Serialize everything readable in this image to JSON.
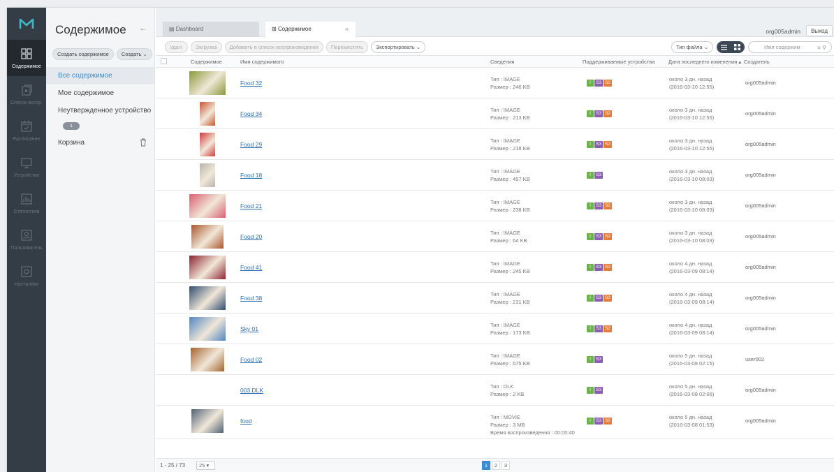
{
  "rail": {
    "items": [
      {
        "label": "Содержимое",
        "icon": "content-icon",
        "active": true
      },
      {
        "label": "Список воспр.",
        "icon": "playlist-icon"
      },
      {
        "label": "Расписание",
        "icon": "schedule-icon"
      },
      {
        "label": "Устройство",
        "icon": "device-icon"
      },
      {
        "label": "Статистика",
        "icon": "statistics-icon"
      },
      {
        "label": "Пользователь",
        "icon": "user-icon"
      },
      {
        "label": "Настройки",
        "icon": "settings-icon"
      }
    ]
  },
  "nav": {
    "title": "Содержимое",
    "back_icon": "←",
    "create_content_label": "Создать содержимое",
    "create_label": "Создать",
    "items": [
      {
        "label": "Все содержимое",
        "active": true
      },
      {
        "label": "Мое содержимое"
      },
      {
        "label": "Неутвержденное устройство"
      },
      {
        "label": "Корзина"
      }
    ],
    "badge": "1"
  },
  "topbar": {
    "tab1": "Dashboard",
    "tab2": "Содержимое",
    "tab_close": "×",
    "user": "org005admin",
    "logout": "Выход"
  },
  "toolbar": {
    "delete": "Удал.",
    "upload": "Загрузка",
    "add_to_playlist": "Добавить в список воспроизведения",
    "move": "Переместить",
    "export": "Экспортировать",
    "file_type": "Тип файла",
    "search_placeholder": "Имя содержим"
  },
  "table": {
    "headers": {
      "content": "Содержимое",
      "name": "Имя содержимого",
      "info": "Сведения",
      "devices": "Поддерживаемые устройства",
      "modified": "Дата последнего изменения",
      "creator": "Создатель"
    },
    "rows": [
      {
        "name": "Food 32",
        "type": "Тип : IMAGE",
        "size": "Размер : 246 KB",
        "devices": [
          "I",
          "S3",
          "S2"
        ],
        "ago": "около 3 дн. назад",
        "date": "(2016-03-10 12:55)",
        "creator": "org005admin",
        "thumb": "#8a9a3a",
        "thumb_w": 52
      },
      {
        "name": "Food 34",
        "type": "Тип : IMAGE",
        "size": "Размер : 213 KB",
        "devices": [
          "I",
          "S3",
          "S2"
        ],
        "ago": "около 3 дн. назад",
        "date": "(2016-03-10 12:55)",
        "creator": "org005admin",
        "thumb": "#c9552e",
        "thumb_w": 22
      },
      {
        "name": "Food 29",
        "type": "Тип : IMAGE",
        "size": "Размер : 218 KB",
        "devices": [
          "I",
          "S3",
          "S2"
        ],
        "ago": "около 3 дн. назад",
        "date": "(2016-03-10 12:55)",
        "creator": "org005admin",
        "thumb": "#d23a3a",
        "thumb_w": 22
      },
      {
        "name": "Food 18",
        "type": "Тип : IMAGE",
        "size": "Размер : 457 KB",
        "devices": [
          "I",
          "S3"
        ],
        "ago": "около 3 дн. назад",
        "date": "(2016-03-10 08:03)",
        "creator": "org005admin",
        "thumb": "#b9b4ad",
        "thumb_w": 22
      },
      {
        "name": "Food 21",
        "type": "Тип : IMAGE",
        "size": "Размер : 238 KB",
        "devices": [
          "I",
          "S3",
          "S2"
        ],
        "ago": "около 3 дн. назад",
        "date": "(2016-03-10 08:03)",
        "creator": "org005admin",
        "thumb": "#d8606f",
        "thumb_w": 52
      },
      {
        "name": "Food 20",
        "type": "Тип : IMAGE",
        "size": "Размер : 64 KB",
        "devices": [
          "I",
          "S3",
          "S2"
        ],
        "ago": "около 3 дн. назад",
        "date": "(2016-03-10 08:03)",
        "creator": "org005admin",
        "thumb": "#a9562b",
        "thumb_w": 46
      },
      {
        "name": "Food 41",
        "type": "Тип : IMAGE",
        "size": "Размер : 245 KB",
        "devices": [
          "I",
          "S3",
          "S2"
        ],
        "ago": "около 4 дн. назад",
        "date": "(2016-03-09 08:14)",
        "creator": "org005admin",
        "thumb": "#8d2430",
        "thumb_w": 52
      },
      {
        "name": "Food 38",
        "type": "Тип : IMAGE",
        "size": "Размер : 231 KB",
        "devices": [
          "I",
          "S3",
          "S2"
        ],
        "ago": "около 4 дн. назад",
        "date": "(2016-03-09 08:14)",
        "creator": "org005admin",
        "thumb": "#2f4d6e",
        "thumb_w": 52
      },
      {
        "name": "Sky 01",
        "type": "Тип : IMAGE",
        "size": "Размер : 173 KB",
        "devices": [
          "I",
          "S3",
          "S2"
        ],
        "ago": "около 4 дн. назад",
        "date": "(2016-03-09 08:14)",
        "creator": "org005admin",
        "thumb": "#4f86c2",
        "thumb_w": 52
      },
      {
        "name": "Food 02",
        "type": "Тип : IMAGE",
        "size": "Размер : 675 KB",
        "devices": [
          "I",
          "S3"
        ],
        "ago": "около 5 дн. назад",
        "date": "(2016-03-08 02:15)",
        "creator": "user002",
        "thumb": "#a4642f",
        "thumb_w": 48
      },
      {
        "name": "003.DLK",
        "type": "Тип : DLK",
        "size": "Размер : 2 KB",
        "devices": [
          "I",
          "S3"
        ],
        "ago": "около 5 дн. назад",
        "date": "(2016-03-08 02:06)",
        "creator": "org005admin",
        "thumb": "",
        "thumb_w": 0
      },
      {
        "name": "food",
        "type": "Тип : MOVIE",
        "size": "Размер : 3 MB",
        "extra": "Время воспроизведения : 00:00:40",
        "devices": [
          "I",
          "S3",
          "S2"
        ],
        "ago": "около 5 дн. назад",
        "date": "(2016-03-08 01:53)",
        "creator": "org005admin",
        "thumb": "#506275",
        "thumb_w": 46
      }
    ]
  },
  "footer": {
    "count": "1 - 25 / 73",
    "page_size": "25",
    "pages": [
      "1",
      "2",
      "3"
    ],
    "current_page": "1"
  },
  "colors": {
    "rail_bg": "#343c46",
    "link": "#2d6fb3",
    "accent": "#3b8cd0",
    "badge_i": "#6cb34b",
    "badge_s3": "#8a5fae",
    "badge_s2": "#e37b3a"
  }
}
